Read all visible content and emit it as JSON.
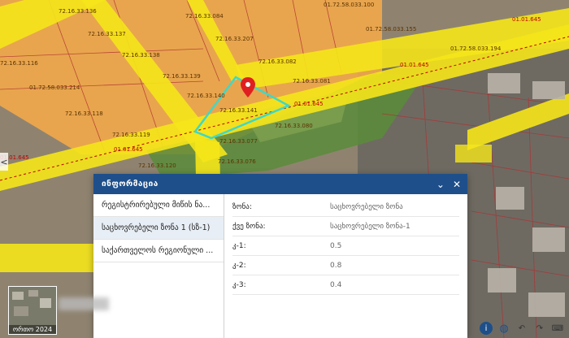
{
  "map": {
    "parcels": [
      "72.16.33.136",
      "72.16.33.084",
      "01.72.58.033.100",
      "72.16.33.137",
      "72.16.33.207",
      "01.72.58.033.155",
      "72.16.33.116",
      "72.16.33.138",
      "72.16.33.082",
      "01.72.58.033.194",
      "72.16.33.139",
      "72.16.33.081",
      "01.72.58.033.214",
      "72.16.33.140",
      "72.16.33.141",
      "72.16.33.118",
      "72.16.33.080",
      "72.16.33.119",
      "72.16.33.077",
      "72.16.33.120",
      "72.16.33.076"
    ],
    "roads": [
      "01.01.645",
      "01.01.645",
      "01.01.645",
      "01.01.645",
      "01.01.645"
    ],
    "side_arrow": "<"
  },
  "panel": {
    "title": "ინფორმაცია",
    "minimize": "⌄",
    "close": "✕",
    "layers": [
      "რეგისტრირებული მიწის ნა...",
      "საცხოვრებელი ზონა 1 (სზ-1)",
      "საქართველოს რეგიონული ..."
    ],
    "attributes": [
      {
        "key": "ზონა:",
        "value": "საცხოვრებელი ზონა"
      },
      {
        "key": "ქვე ზონა:",
        "value": "საცხოვრებელი ზონა-1"
      },
      {
        "key": "კ-1:",
        "value": "0.5"
      },
      {
        "key": "კ-2:",
        "value": "0.8"
      },
      {
        "key": "კ-3:",
        "value": "0.4"
      }
    ]
  },
  "basemap": {
    "label": "ორთო 2024"
  },
  "toolbar": {
    "icons": [
      "info-icon",
      "globe-icon",
      "undo-icon",
      "redo-icon",
      "keyboard-icon"
    ],
    "glyphs": [
      "i",
      "◍",
      "↶",
      "↷",
      "⌨"
    ],
    "colors": [
      "#1e4f8a",
      "#1e4f8a",
      "#333333",
      "#333333",
      "#333333"
    ]
  },
  "colors": {
    "accent": "#1e4f8a",
    "parcel_fill": "#f2a84a",
    "road_fill": "#f5e61a",
    "zone_fill": "#5a8c3a",
    "selection": "#3fd8c6",
    "marker": "#e02020"
  }
}
